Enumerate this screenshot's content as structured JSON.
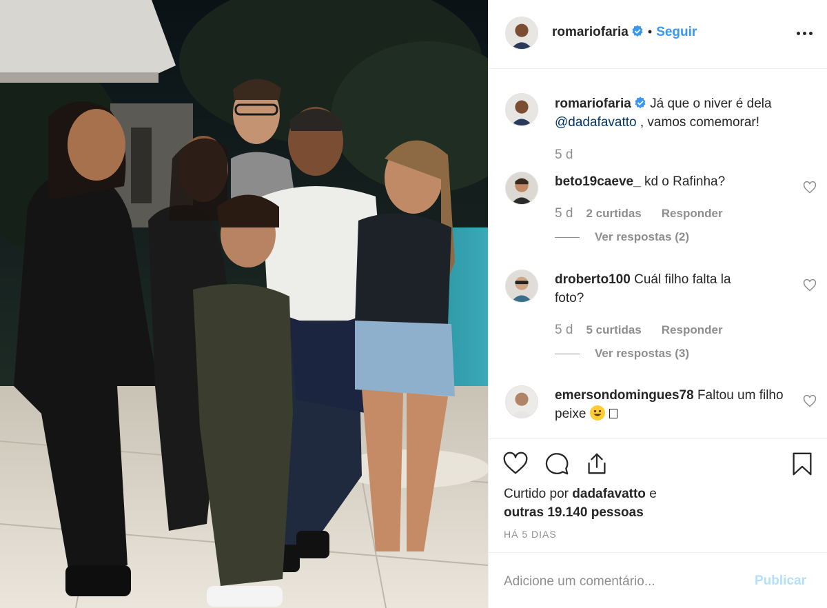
{
  "post": {
    "author": "romariofaria",
    "follow_label": "Seguir",
    "separator": "•"
  },
  "caption": {
    "username": "romariofaria",
    "text_1": "Já que o niver é dela",
    "mention": "@dadafavatto",
    "text_2": ", vamos comemorar!",
    "age": "5 d"
  },
  "comments": [
    {
      "username": "beto19caeve_",
      "text": "kd o Rafinha?",
      "age": "5 d",
      "likes": "2 curtidas",
      "reply_label": "Responder",
      "view_replies": "Ver respostas (2)"
    },
    {
      "username": "droberto100",
      "text": "Cuál filho falta la foto?",
      "age": "5 d",
      "likes": "5 curtidas",
      "reply_label": "Responder",
      "view_replies": "Ver respostas (3)"
    },
    {
      "username": "emersondomingues78",
      "text": "Faltou um filho peixe"
    }
  ],
  "engagement": {
    "liked_prefix": "Curtido por",
    "liked_user": "dadafavatto",
    "liked_conj": "e",
    "liked_others": "outras 19.140 pessoas",
    "post_age": "HÁ 5 DIAS"
  },
  "add_comment": {
    "placeholder": "Adicione um comentário...",
    "publish_label": "Publicar"
  },
  "icons": {
    "verified": "verified-badge-icon",
    "more": "more-options-icon",
    "like": "heart-icon",
    "comment": "comment-bubble-icon",
    "share": "share-icon",
    "save": "bookmark-icon"
  },
  "colors": {
    "accent": "#3897f0",
    "text": "#262626",
    "muted": "#8e8e8e",
    "publish_disabled": "#b2dffc"
  }
}
